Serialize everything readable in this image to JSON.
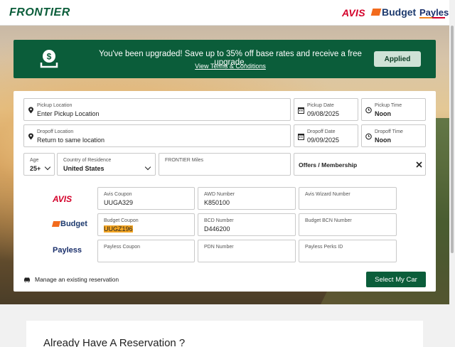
{
  "header": {
    "logo": "FRONTIER",
    "brands": {
      "avis": "AVIS",
      "budget": "Budget",
      "payless": "Payless"
    }
  },
  "banner": {
    "message": "You've been upgraded! Save up to 35% off base rates and receive a free upgrade.",
    "link": "View Terms & Conditions",
    "applied_label": "Applied",
    "icon": "dollar-tray-icon"
  },
  "form": {
    "pickup_location": {
      "label": "Pickup Location",
      "placeholder": "Enter Pickup Location"
    },
    "pickup_date": {
      "label": "Pickup Date",
      "value": "09/08/2025"
    },
    "pickup_time": {
      "label": "Pickup Time",
      "value": "Noon"
    },
    "dropoff_location": {
      "label": "Dropoff Location",
      "value": "Return to same location"
    },
    "dropoff_date": {
      "label": "Dropoff Date",
      "value": "09/09/2025"
    },
    "dropoff_time": {
      "label": "Dropoff Time",
      "value": "Noon"
    },
    "age": {
      "label": "Age",
      "value": "25+"
    },
    "country": {
      "label": "Country of Residence",
      "value": "United States"
    },
    "miles": {
      "label": "FRONTIER Miles",
      "value": ""
    },
    "offers": {
      "label": "Offers / Membership"
    },
    "avis": {
      "coupon": {
        "label": "Avis Coupon",
        "value": "UUGA329"
      },
      "awd": {
        "label": "AWD Number",
        "value": "K850100"
      },
      "wizard": {
        "label": "Avis Wizard Number",
        "value": ""
      }
    },
    "budget": {
      "coupon": {
        "label": "Budget Coupon",
        "value": "UUGZ196"
      },
      "bcd": {
        "label": "BCD Number",
        "value": "D446200"
      },
      "bcn": {
        "label": "Budget BCN Number",
        "value": ""
      }
    },
    "payless": {
      "coupon": {
        "label": "Payless Coupon",
        "value": ""
      },
      "pdn": {
        "label": "PDN Number",
        "value": ""
      },
      "perks": {
        "label": "Payless Perks ID",
        "value": ""
      }
    },
    "manage_label": "Manage an existing reservation",
    "select_label": "Select My Car"
  },
  "lower": {
    "title": "Already Have A Reservation ?"
  },
  "colors": {
    "brand_green": "#0b5d3a",
    "avis_red": "#d4002a",
    "budget_orange": "#f26b1d",
    "highlight": "#f5a623"
  }
}
